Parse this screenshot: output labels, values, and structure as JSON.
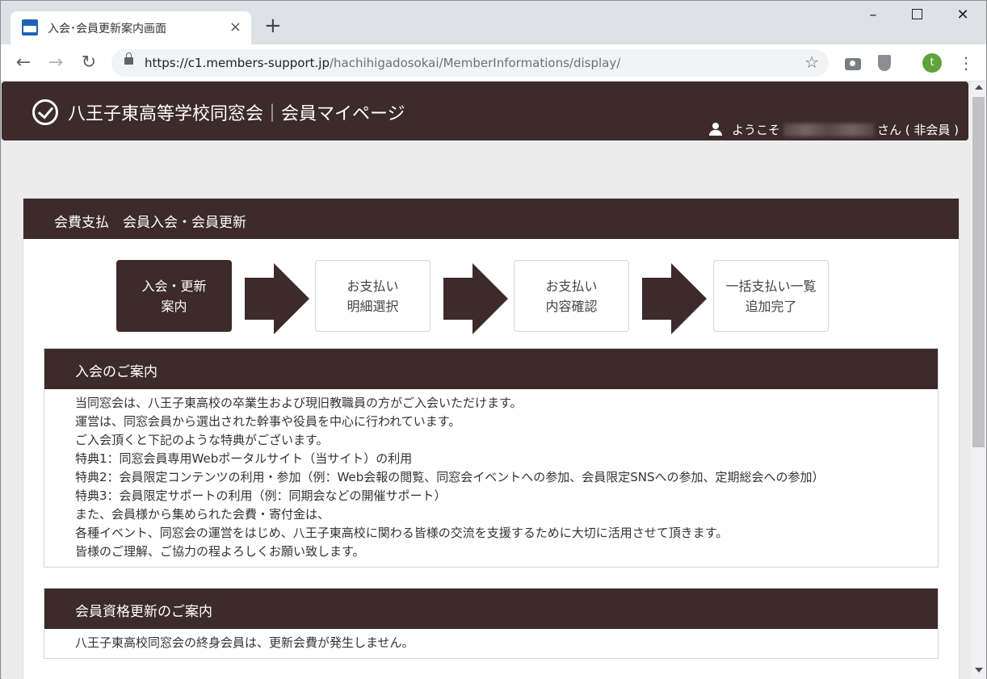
{
  "browser": {
    "tab_title": "入会･会員更新案内画面",
    "tab_close": "×",
    "new_tab": "+",
    "url_host": "https://c1.members-support.jp",
    "url_path": "/hachihigadosokai/MemberInformations/display/",
    "avatar_letter": "t",
    "icons": [
      "back-arrow-icon",
      "forward-arrow-icon",
      "reload-icon",
      "lock-icon",
      "star-icon",
      "camera-icon",
      "shield-icon",
      "kebab-menu-icon"
    ]
  },
  "header": {
    "site_title": "八王子東高等学校同窓会｜会員マイページ",
    "welcome_prefix": "ようこそ",
    "welcome_suffix": "さん ( 非会員 )"
  },
  "panel": {
    "title": "会費支払　会員入会・会員更新"
  },
  "steps": [
    {
      "line1": "入会・更新",
      "line2": "案内",
      "active": true
    },
    {
      "line1": "お支払い",
      "line2": "明細選択",
      "active": false
    },
    {
      "line1": "お支払い",
      "line2": "内容確認",
      "active": false
    },
    {
      "line1": "一括支払い一覧",
      "line2": "追加完了",
      "active": false
    }
  ],
  "join_section": {
    "title": "入会のご案内",
    "lines": [
      "当同窓会は、八王子東高校の卒業生および現旧教職員の方がご入会いただけます。",
      "運営は、同窓会員から選出された幹事や役員を中心に行われています。",
      "ご入会頂くと下記のような特典がございます。",
      "特典1：同窓会員専用Webポータルサイト（当サイト）の利用",
      "特典2：会員限定コンテンツの利用・参加（例：Web会報の閲覧、同窓会イベントへの参加、会員限定SNSへの参加、定期総会への参加）",
      "特典3：会員限定サポートの利用（例：同期会などの開催サポート）",
      "また、会員様から集められた会費・寄付金は、",
      "各種イベント、同窓会の運営をはじめ、八王子東高校に関わる皆様の交流を支援するために大切に活用させて頂きます。",
      "皆様のご理解、ご協力の程よろしくお願い致します。"
    ]
  },
  "renewal_section": {
    "title": "会員資格更新のご案内",
    "lines": [
      "八王子東高校同窓会の終身会員は、更新会費が発生しません。"
    ]
  },
  "colors": {
    "brand_dark": "#3d2a2a",
    "page_bg": "#ececec"
  }
}
